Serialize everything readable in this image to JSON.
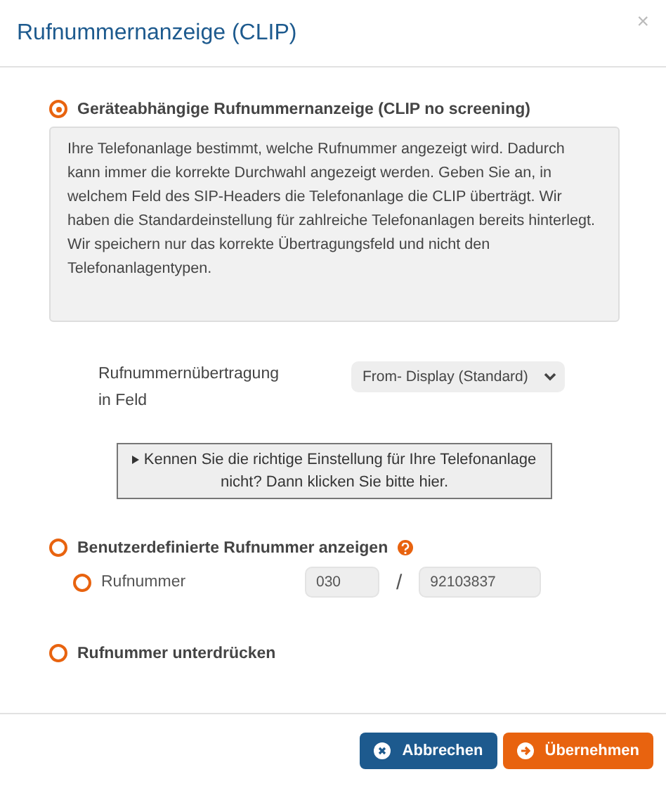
{
  "dialog": {
    "title": "Rufnummernanzeige (CLIP)",
    "close": "×"
  },
  "options": [
    {
      "label": "Geräteabhängige Rufnummernanzeige (CLIP no screening)",
      "selected": true,
      "help": false,
      "info": "Ihre Telefonanlage bestimmt, welche Rufnummer angezeigt wird. Dadurch kann immer die korrekte Durchwahl angezeigt werden. Geben Sie an, in welchem Feld des SIP-Headers die Telefonanlage die CLIP überträgt. Wir haben die Standardeinstellung für zahlreiche Telefonanlagen bereits hinterlegt. Wir speichern nur das korrekte Übertragungsfeld und nicht den Telefonanlagentypen.",
      "field_label": "Rufnummernübertragung in Feld",
      "field_value": "From- Display (Standard)",
      "hint_button": "Kennen Sie die richtige Einstellung für Ihre Telefonanlage nicht? Dann klicken Sie bitte hier."
    },
    {
      "label": "Benutzerdefinierte Rufnummer anzeigen",
      "selected": false,
      "help": true,
      "sub": {
        "label": "Rufnummer",
        "selected": false,
        "area_code": "030",
        "separator": "/",
        "number": "92103837",
        "disabled": true
      }
    },
    {
      "label": "Rufnummer unterdrücken",
      "selected": false,
      "help": false
    }
  ],
  "buttons": [
    {
      "label": "Abbrechen",
      "kind": "cancel"
    },
    {
      "label": "Übernehmen",
      "kind": "confirm"
    }
  ]
}
